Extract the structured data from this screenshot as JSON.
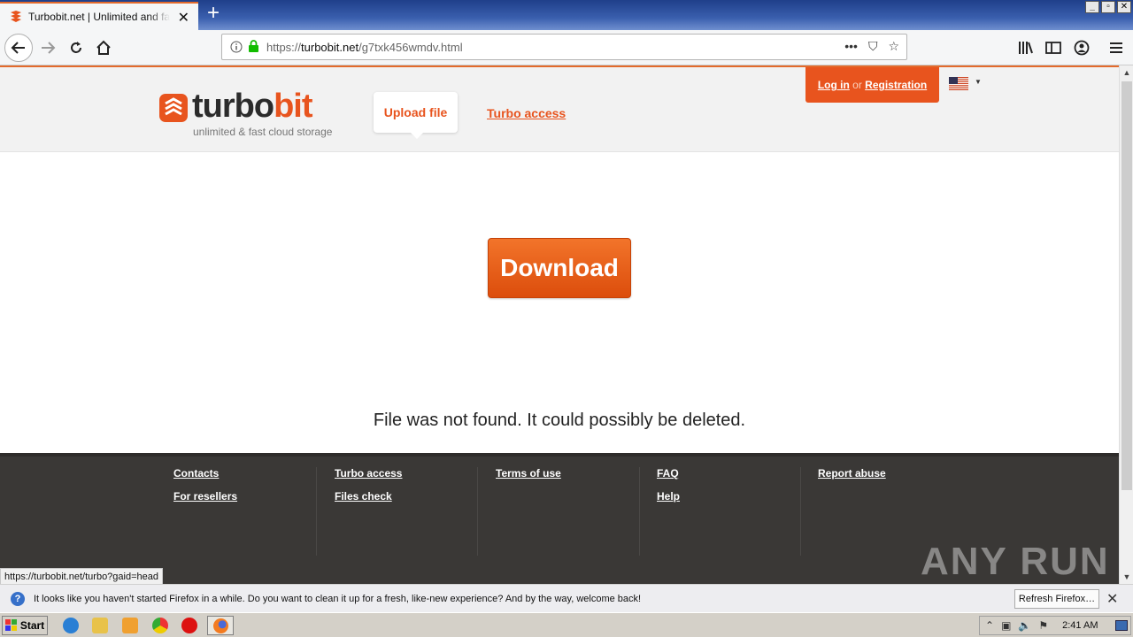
{
  "browser": {
    "tab_title": "Turbobit.net | Unlimited and fast f",
    "url_prefix": "https://",
    "url_host": "turbobit.net",
    "url_path": "/g7txk456wmdv.html",
    "status_url": "https://turbobit.net/turbo?gaid=head"
  },
  "header": {
    "logo_dark": "turbo",
    "logo_orange": "bit",
    "tagline": "unlimited & fast cloud storage",
    "upload_label": "Upload file",
    "turbo_access_label": "Turbo access",
    "login_label": "Log in",
    "or_label": "or",
    "register_label": "Registration"
  },
  "main": {
    "download_label": "Download",
    "not_found_message": "File was not found. It could possibly be deleted."
  },
  "footer": {
    "col1": [
      "Contacts",
      "For resellers"
    ],
    "col2": [
      "Turbo access",
      "Files check"
    ],
    "col3": [
      "Terms of use"
    ],
    "col4": [
      "FAQ",
      "Help"
    ],
    "col5": [
      "Report abuse"
    ]
  },
  "notification": {
    "message": "It looks like you haven't started Firefox in a while. Do you want to clean it up for a fresh, like-new experience? And by the way, welcome back!",
    "button_label": "Refresh Firefox…"
  },
  "taskbar": {
    "start_label": "Start",
    "clock": "2:41 AM"
  },
  "watermark": "ANY RUN",
  "colors": {
    "brand_orange": "#e8541e",
    "footer_bg": "#3a3836"
  }
}
